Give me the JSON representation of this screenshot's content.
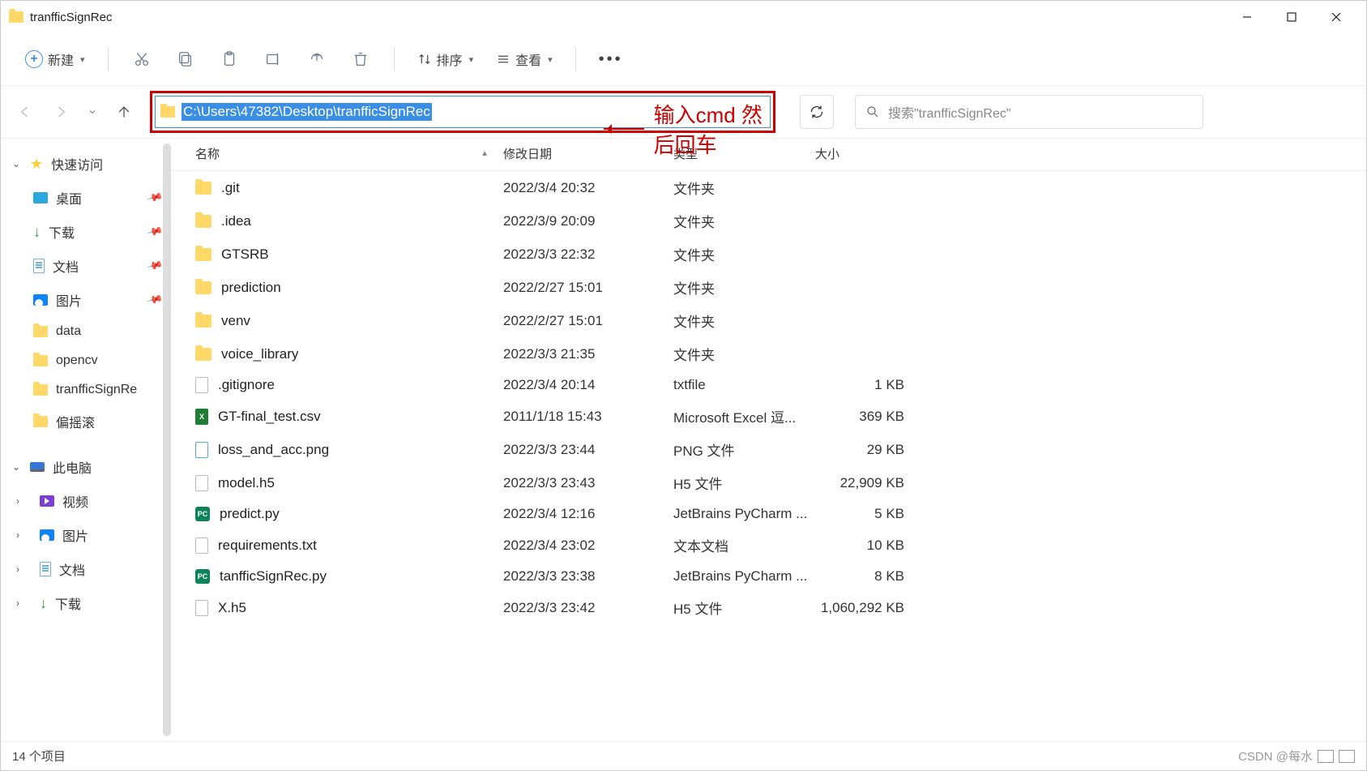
{
  "window": {
    "title": "tranfficSignRec"
  },
  "toolbar": {
    "new_label": "新建",
    "sort_label": "排序",
    "view_label": "查看"
  },
  "nav": {
    "address_path": "C:\\Users\\47382\\Desktop\\tranfficSignRec",
    "search_placeholder": "搜索\"tranfficSignRec\""
  },
  "annotation": {
    "text": "输入cmd 然后回车"
  },
  "sidebar": {
    "quick_access": "快速访问",
    "desktop": "桌面",
    "downloads": "下载",
    "documents": "文档",
    "pictures": "图片",
    "data": "data",
    "opencv": "opencv",
    "tranffic": "tranfficSignRe",
    "music": "偏摇滚",
    "this_pc": "此电脑",
    "videos": "视频",
    "pictures2": "图片",
    "documents2": "文档",
    "downloads2": "下载"
  },
  "columns": {
    "name": "名称",
    "date": "修改日期",
    "type": "类型",
    "size": "大小"
  },
  "files": [
    {
      "name": ".git",
      "date": "2022/3/4 20:32",
      "type": "文件夹",
      "size": "",
      "icon": "folder"
    },
    {
      "name": ".idea",
      "date": "2022/3/9 20:09",
      "type": "文件夹",
      "size": "",
      "icon": "folder"
    },
    {
      "name": "GTSRB",
      "date": "2022/3/3 22:32",
      "type": "文件夹",
      "size": "",
      "icon": "folder"
    },
    {
      "name": "prediction",
      "date": "2022/2/27 15:01",
      "type": "文件夹",
      "size": "",
      "icon": "folder"
    },
    {
      "name": "venv",
      "date": "2022/2/27 15:01",
      "type": "文件夹",
      "size": "",
      "icon": "folder"
    },
    {
      "name": "voice_library",
      "date": "2022/3/3 21:35",
      "type": "文件夹",
      "size": "",
      "icon": "folder"
    },
    {
      "name": ".gitignore",
      "date": "2022/3/4 20:14",
      "type": "txtfile",
      "size": "1 KB",
      "icon": "file"
    },
    {
      "name": "GT-final_test.csv",
      "date": "2011/1/18 15:43",
      "type": "Microsoft Excel 逗...",
      "size": "369 KB",
      "icon": "xls"
    },
    {
      "name": "loss_and_acc.png",
      "date": "2022/3/3 23:44",
      "type": "PNG 文件",
      "size": "29 KB",
      "icon": "img"
    },
    {
      "name": "model.h5",
      "date": "2022/3/3 23:43",
      "type": "H5 文件",
      "size": "22,909 KB",
      "icon": "file"
    },
    {
      "name": "predict.py",
      "date": "2022/3/4 12:16",
      "type": "JetBrains PyCharm ...",
      "size": "5 KB",
      "icon": "py"
    },
    {
      "name": "requirements.txt",
      "date": "2022/3/4 23:02",
      "type": "文本文档",
      "size": "10 KB",
      "icon": "file"
    },
    {
      "name": "tanfficSignRec.py",
      "date": "2022/3/3 23:38",
      "type": "JetBrains PyCharm ...",
      "size": "8 KB",
      "icon": "py"
    },
    {
      "name": "X.h5",
      "date": "2022/3/3 23:42",
      "type": "H5 文件",
      "size": "1,060,292 KB",
      "icon": "file"
    }
  ],
  "status": {
    "count": "14 个项目",
    "watermark": "CSDN @每水"
  }
}
